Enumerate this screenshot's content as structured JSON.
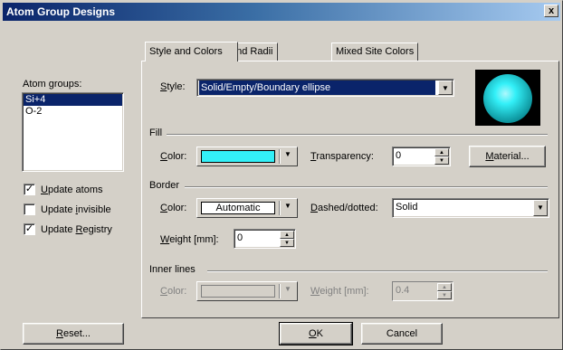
{
  "window": {
    "title": "Atom Group Designs",
    "close_label": "x"
  },
  "left": {
    "groups_label": "Atom groups:",
    "groups": [
      "Si+4",
      "O-2"
    ],
    "checkboxes": [
      {
        "label_u": "U",
        "label_rest": "pdate atoms",
        "checked": true,
        "mark": "✓"
      },
      {
        "label_pre": "Update ",
        "label_u": "i",
        "label_rest": "nvisible",
        "checked": false,
        "mark": ""
      },
      {
        "label_pre": "Update ",
        "label_u": "R",
        "label_rest": "egistry",
        "checked": true,
        "mark": "✓"
      }
    ],
    "reset_u": "R",
    "reset_rest": "eset..."
  },
  "tabs": [
    "Style and Colors",
    "Model and Radii",
    "Mixed Site Colors"
  ],
  "style": {
    "label_u": "S",
    "label_rest": "tyle:",
    "value": "Solid/Empty/Boundary ellipse"
  },
  "fill": {
    "title": "Fill",
    "color_label_u": "C",
    "color_label_rest": "olor:",
    "color": "#33f0f8",
    "transparency_label_u": "T",
    "transparency_label_rest": "ransparency:",
    "transparency": "0",
    "material_u": "M",
    "material_rest": "aterial..."
  },
  "border": {
    "title": "Border",
    "color_label_u": "C",
    "color_label_rest": "olor:",
    "color_value": "Automatic",
    "dashed_label_u": "D",
    "dashed_label_rest": "ashed/dotted:",
    "dashed_value": "Solid",
    "weight_label_u": "W",
    "weight_label_rest": "eight [mm]:",
    "weight": "0"
  },
  "inner": {
    "title": "Inner lines",
    "color_label_u": "C",
    "color_label_rest": "olor:",
    "weight_label_u": "W",
    "weight_label_rest": "eight [mm]:",
    "weight": "0.4"
  },
  "footer": {
    "ok_u": "O",
    "ok_rest": "K",
    "cancel": "Cancel"
  },
  "colors": {
    "title_start": "#0a246a",
    "face": "#d4d0c8",
    "selection": "#0a246a",
    "sphere": "#33f0f8"
  },
  "icons": {
    "dropdown": "dropdown-arrow-icon",
    "spin_up": "spin-up-icon",
    "spin_down": "spin-down-icon"
  }
}
